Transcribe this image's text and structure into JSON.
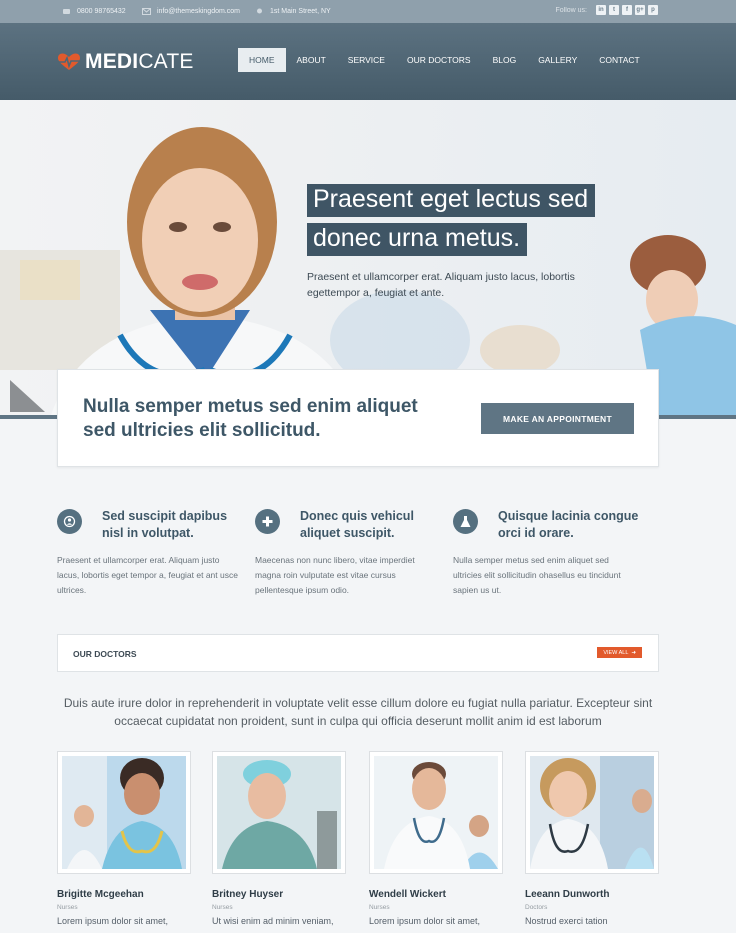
{
  "topbar": {
    "phone": "0800 98765432",
    "email": "info@themeskingdom.com",
    "address": "1st Main Street, NY",
    "follow_label": "Follow us:",
    "social": [
      {
        "icon": "linkedin-icon",
        "glyph": "in"
      },
      {
        "icon": "twitter-icon",
        "glyph": "t"
      },
      {
        "icon": "facebook-icon",
        "glyph": "f"
      },
      {
        "icon": "googleplus-icon",
        "glyph": "g+"
      },
      {
        "icon": "pinterest-icon",
        "glyph": "p"
      }
    ]
  },
  "header": {
    "logo_bold": "MEDI",
    "logo_light": "CATE",
    "nav": [
      "HOME",
      "ABOUT",
      "SERVICE",
      "OUR DOCTORS",
      "BLOG",
      "GALLERY",
      "CONTACT"
    ],
    "active_nav": "HOME"
  },
  "hero": {
    "title_line1": "Praesent eget lectus sed",
    "title_line2": "donec urna metus.",
    "text": "Praesent et ullamcorper erat. Aliquam justo lacus, lobortis egettempor a, feugiat et ante."
  },
  "appointment": {
    "text": "Nulla semper metus sed enim aliquet sed ultricies elit sollicitud.",
    "button": "MAKE AN APPOINTMENT"
  },
  "features": [
    {
      "icon": "user-icon",
      "title": "Sed suscipit dapibus nisl in volutpat.",
      "text": "Praesent et ullamcorper erat. Aliquam justo lacus, lobortis eget tempor a, feugiat et ant usce ultrices."
    },
    {
      "icon": "plus-icon",
      "title": "Donec quis vehicul aliquet suscipit.",
      "text": "Maecenas non nunc libero, vitae imperdiet magna roin vulputate est vitae cursus pellentesque ipsum odio."
    },
    {
      "icon": "flask-icon",
      "title": "Quisque lacinia congue orci id orare.",
      "text": "Nulla semper metus sed enim aliquet sed ultricies elit sollicitudin ohasellus eu tincidunt sapien us ut."
    }
  ],
  "doctors_section": {
    "label": "OUR DOCTORS",
    "view_all": "VIEW ALL",
    "intro": "Duis aute irure dolor in reprehenderit in voluptate velit esse cillum dolore eu fugiat nulla pariatur. Excepteur sint occaecat cupidatat non proident, sunt in culpa qui officia deserunt mollit anim id est laborum"
  },
  "doctors": [
    {
      "name": "Brigitte Mcgeehan",
      "role": "Nurses",
      "desc": "Lorem ipsum dolor sit amet,"
    },
    {
      "name": "Britney Huyser",
      "role": "Nurses",
      "desc": "Ut wisi enim ad minim veniam,"
    },
    {
      "name": "Wendell Wickert",
      "role": "Nurses",
      "desc": "Lorem ipsum dolor sit amet,"
    },
    {
      "name": "Leeann Dunworth",
      "role": "Doctors",
      "desc": "Nostrud exerci tation"
    }
  ],
  "colors": {
    "header": "#4f6675",
    "accent_orange": "#e25a2c",
    "heading": "#3e5767"
  }
}
